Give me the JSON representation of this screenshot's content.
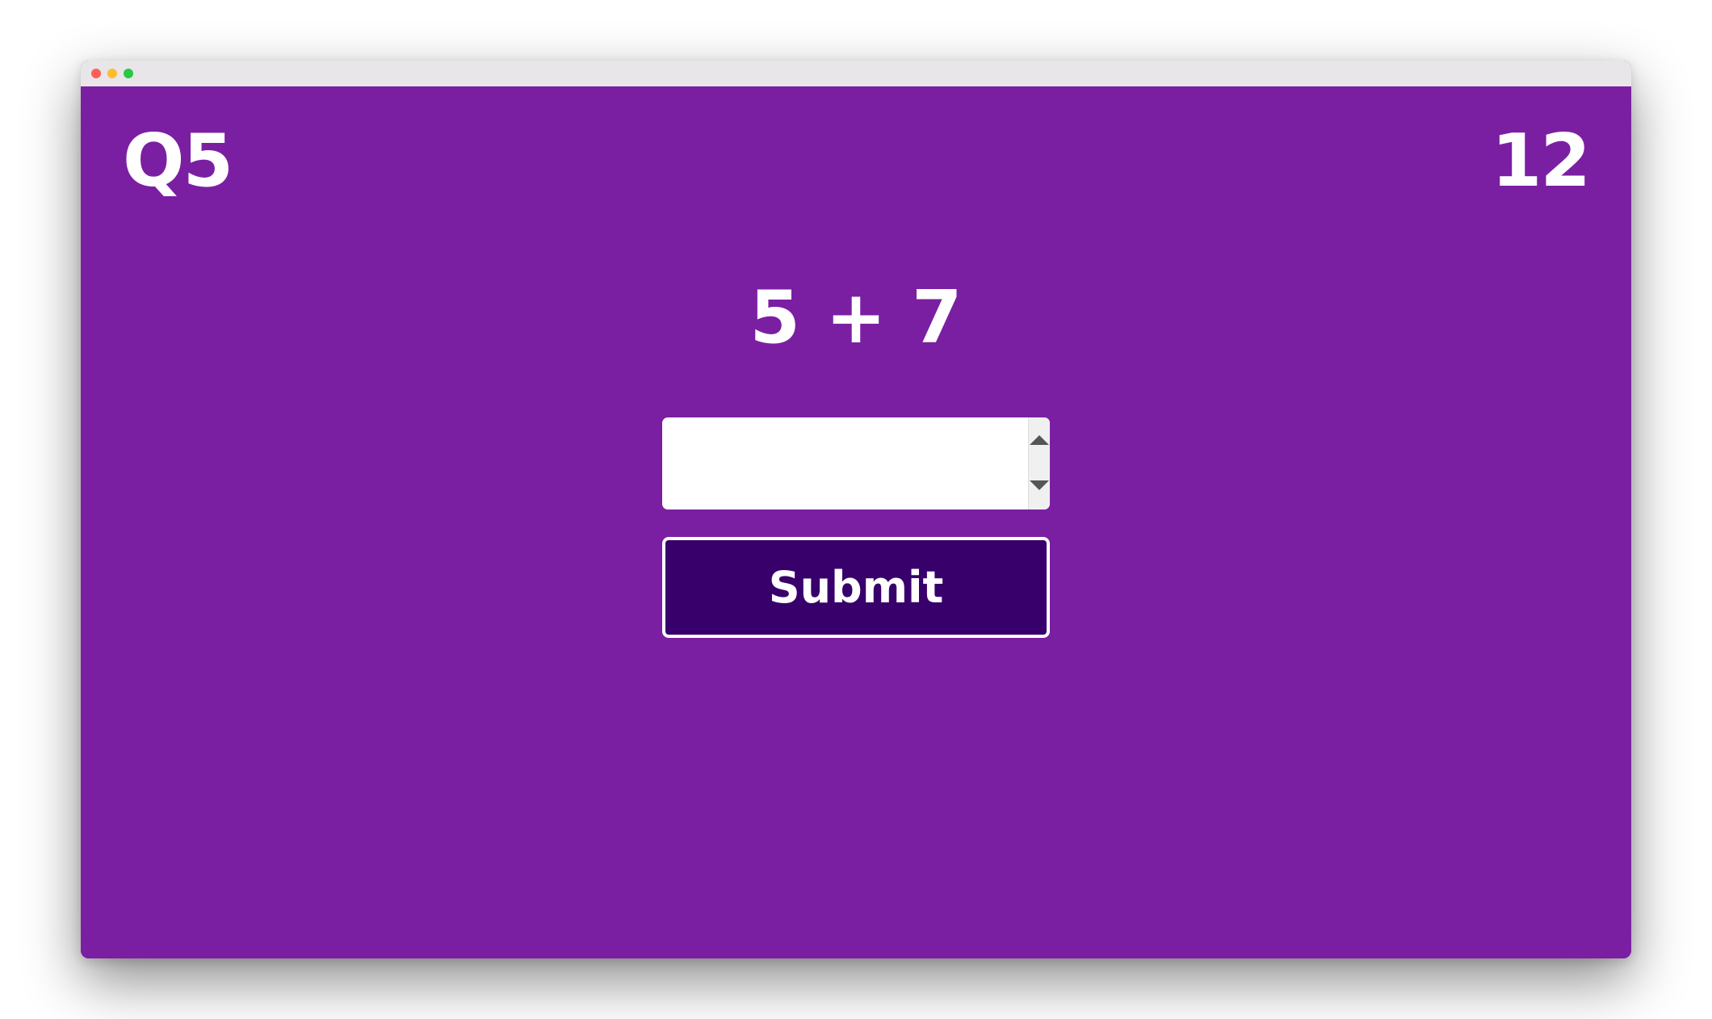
{
  "quiz": {
    "question_number": "Q5",
    "score": "12",
    "problem": "5 + 7"
  },
  "answer": {
    "value": "",
    "placeholder": ""
  },
  "submit": {
    "label": "Submit"
  },
  "colors": {
    "background": "#7b1fa2",
    "button": "#38006b",
    "text": "#ffffff"
  }
}
